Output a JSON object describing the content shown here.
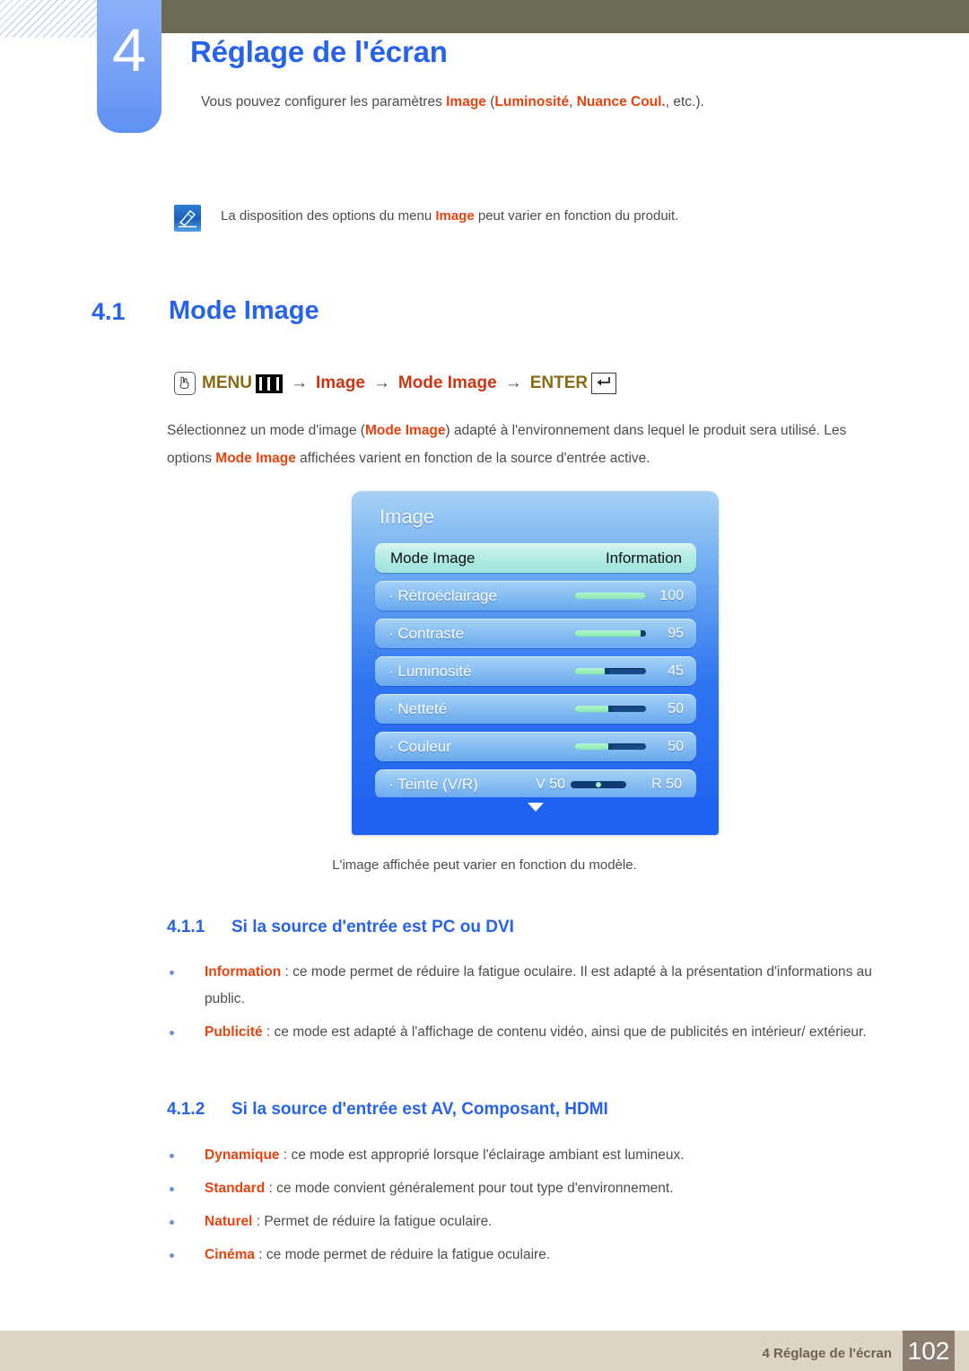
{
  "chapter": {
    "number": "4",
    "title": "Réglage de l'écran",
    "intro_prefix": "Vous pouvez configurer les paramètres ",
    "intro_kw1": "Image",
    "intro_mid1": " (",
    "intro_kw2": "Luminosité",
    "intro_mid2": ", ",
    "intro_kw3": "Nuance Coul.",
    "intro_suffix": ", etc.)."
  },
  "note": {
    "icon": "note-pen-icon",
    "text_prefix": "La disposition des options du menu ",
    "keyword": "Image",
    "text_suffix": " peut varier en fonction du produit."
  },
  "section": {
    "number": "4.1",
    "title": "Mode Image"
  },
  "menu_path": {
    "hand_icon": "hand-press-icon",
    "menu_label": "MENU",
    "menu_bars_icon": "menu-bars-icon",
    "arrow": "→",
    "step1": "Image",
    "step2": "Mode Image",
    "enter_label": "ENTER",
    "enter_icon": "enter-return-icon"
  },
  "paragraph": {
    "p1": "Sélectionnez un mode d'image (",
    "kw1": "Mode Image",
    "p2": ") adapté à l'environnement dans lequel le produit sera utilisé. Les options ",
    "kw2": "Mode Image",
    "p3": " affichées varient en fonction de la source d'entrée active."
  },
  "osd": {
    "title": "Image",
    "rows": [
      {
        "label": "Mode Image",
        "value": "Information",
        "type": "select",
        "selected": true
      },
      {
        "label": "· Rétroéclairage",
        "value": "100",
        "type": "slider",
        "fill_pct": 100,
        "selected": false
      },
      {
        "label": "· Contraste",
        "value": "95",
        "type": "slider",
        "fill_pct": 95,
        "selected": false
      },
      {
        "label": "· Luminosité",
        "value": "45",
        "type": "slider",
        "fill_pct": 45,
        "selected": false
      },
      {
        "label": "· Netteté",
        "value": "50",
        "type": "slider",
        "fill_pct": 50,
        "selected": false
      },
      {
        "label": "· Couleur",
        "value": "50",
        "type": "slider",
        "fill_pct": 50,
        "selected": false
      },
      {
        "label": "· Teinte (V/R)",
        "type": "tint",
        "left_value": "V 50",
        "right_value": "R 50",
        "selected": false
      }
    ],
    "scroll_icon": "chevron-down-icon",
    "caption": "L'image affichée peut varier en fonction du modèle."
  },
  "subsections": [
    {
      "number": "4.1.1",
      "title": "Si la source d'entrée est PC ou DVI",
      "bullets": [
        {
          "term": "Information",
          "desc": " : ce mode permet de réduire la fatigue oculaire. Il est adapté à la présentation d'informations au public."
        },
        {
          "term": "Publicité",
          "desc": " : ce mode est adapté à l'affichage de contenu vidéo, ainsi que de publicités en intérieur/ extérieur."
        }
      ]
    },
    {
      "number": "4.1.2",
      "title": "Si la source d'entrée est AV, Composant, HDMI",
      "bullets": [
        {
          "term": "Dynamique",
          "desc": " : ce mode est approprié lorsque l'éclairage ambiant est lumineux."
        },
        {
          "term": "Standard",
          "desc": " : ce mode convient généralement pour tout type d'environnement."
        },
        {
          "term": "Naturel",
          "desc": " : Permet de réduire la fatigue oculaire."
        },
        {
          "term": "Cinéma",
          "desc": " : ce mode permet de réduire la fatigue oculaire."
        }
      ]
    }
  ],
  "footer": {
    "text": "4 Réglage de l'écran",
    "page": "102"
  },
  "colors": {
    "heading_blue": "#2763e8",
    "keyword_orange": "#e8430f",
    "menu_gold": "#8a6a12",
    "menu_red": "#cf3412",
    "header_olive": "#6c6a55",
    "footer_beige": "#ddd6c4",
    "footer_page_brown": "#8c7f71",
    "osd_blue": "#1f62ef",
    "osd_slider_green": "#85eaaf"
  }
}
